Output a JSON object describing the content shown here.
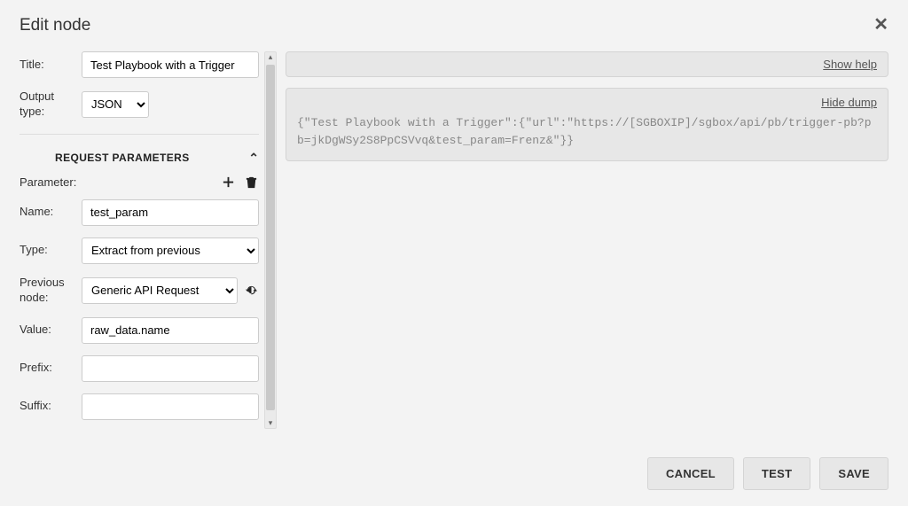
{
  "header": {
    "title": "Edit node"
  },
  "form": {
    "title_label": "Title:",
    "title_value": "Test Playbook with a Trigger",
    "output_type_label": "Output type:",
    "output_type_value": "JSON"
  },
  "section": {
    "title": "REQUEST PARAMETERS",
    "parameter_label": "Parameter:",
    "name_label": "Name:",
    "name_value": "test_param",
    "type_label": "Type:",
    "type_value": "Extract from previous",
    "prev_node_label": "Previous node:",
    "prev_node_value": "Generic API Request",
    "value_label": "Value:",
    "value_value": "raw_data.name",
    "prefix_label": "Prefix:",
    "prefix_value": "",
    "suffix_label": "Suffix:",
    "suffix_value": ""
  },
  "right": {
    "show_help": "Show help",
    "hide_dump": "Hide dump",
    "dump_text": "{\"Test Playbook with a Trigger\":{\"url\":\"https://[SGBOXIP]/sgbox/api/pb/trigger-pb?pb=jkDgWSy2S8PpCSVvq&test_param=Frenz&\"}}"
  },
  "footer": {
    "cancel": "CANCEL",
    "test": "TEST",
    "save": "SAVE"
  }
}
